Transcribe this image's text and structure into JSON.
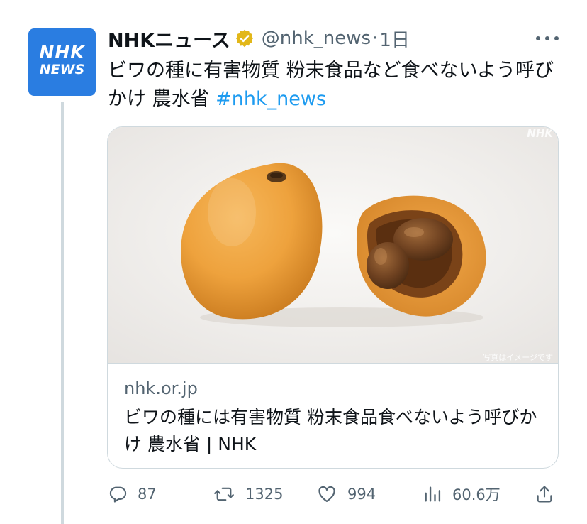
{
  "account": {
    "avatar_line1": "NHK",
    "avatar_line2": "NEWS",
    "display_name": "NHKニュース",
    "handle": "@nhk_news",
    "separator": "·",
    "time": "1日"
  },
  "tweet": {
    "text": "ビワの種に有害物質 粉末食品など食べないよう呼びかけ 農水省 ",
    "hashtag": "#nhk_news"
  },
  "card": {
    "image_watermark": "NHK",
    "image_caption": "写真はイメージです",
    "domain": "nhk.or.jp",
    "title": "ビワの種には有害物質 粉末食品食べないよう呼びかけ 農水省 | NHK"
  },
  "actions": {
    "replies": "87",
    "retweets": "1325",
    "likes": "994",
    "views": "60.6万"
  },
  "colors": {
    "avatar_bg": "#2a7de1",
    "hashtag": "#1d9bf0",
    "verified_badge": "#e2b719",
    "muted_text": "#536471"
  }
}
